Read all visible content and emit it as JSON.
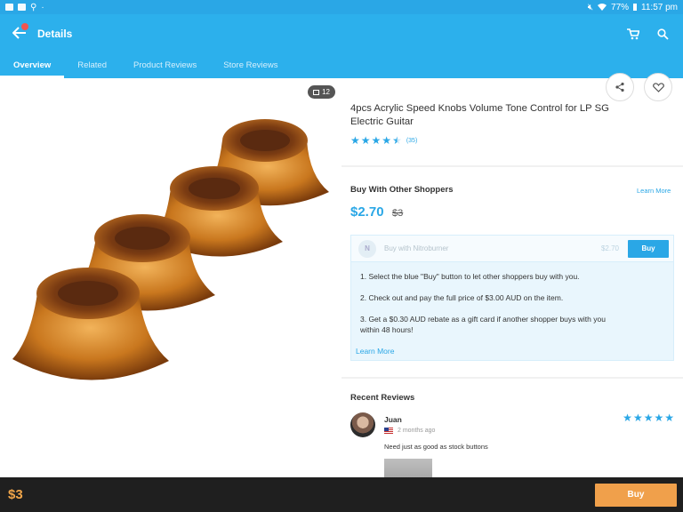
{
  "status_bar": {
    "battery": "77%",
    "time": "11:57 pm"
  },
  "app_bar": {
    "title": "Details"
  },
  "tabs": [
    {
      "label": "Overview"
    },
    {
      "label": "Related"
    },
    {
      "label": "Product Reviews"
    },
    {
      "label": "Store Reviews"
    }
  ],
  "gallery": {
    "image_count": "12"
  },
  "product": {
    "title": "4pcs Acrylic Speed Knobs Volume Tone Control for LP SG Electric Guitar",
    "rating": 4.5,
    "review_count": "(35)"
  },
  "group_buy": {
    "title": "Buy With Other Shoppers",
    "learn_more": "Learn More",
    "price": "$2.70",
    "original_price": "$3",
    "shopper_name": "Buy with Nitroburner",
    "shopper_initial": "N",
    "shopper_price": "$2.70",
    "buy_label": "Buy",
    "steps": [
      "1. Select the blue \"Buy\" button to let other shoppers buy with you.",
      "2. Check out and pay the full price of $3.00 AUD on the item.",
      "3. Get a $0.30 AUD rebate as a gift card if another shopper buys with you within 48 hours!"
    ],
    "box_learn_more": "Learn More"
  },
  "reviews": {
    "title": "Recent Reviews",
    "items": [
      {
        "name": "Juan",
        "time": "2 months ago",
        "stars": 5,
        "text": "Need just as good as stock buttons"
      }
    ]
  },
  "bottom_bar": {
    "price": "$3",
    "buy_label": "Buy"
  },
  "colors": {
    "accent": "#2cb0ec",
    "buy_orange": "#f0a04b",
    "price_orange": "#f0a54a"
  }
}
